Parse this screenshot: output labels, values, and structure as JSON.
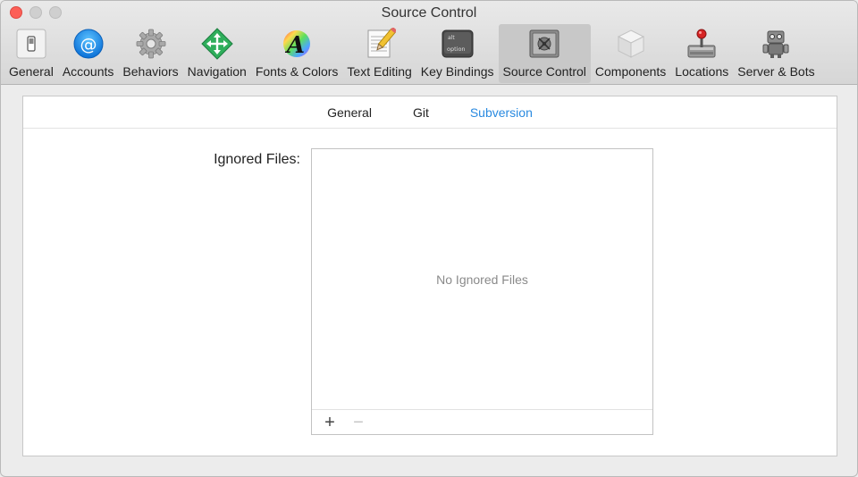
{
  "window": {
    "title": "Source Control"
  },
  "toolbar": {
    "items": [
      {
        "label": "General",
        "icon": "general-switch-icon"
      },
      {
        "label": "Accounts",
        "icon": "at-sign-icon"
      },
      {
        "label": "Behaviors",
        "icon": "gear-icon"
      },
      {
        "label": "Navigation",
        "icon": "arrows-diamond-icon"
      },
      {
        "label": "Fonts & Colors",
        "icon": "font-color-icon"
      },
      {
        "label": "Text Editing",
        "icon": "pencil-paper-icon"
      },
      {
        "label": "Key Bindings",
        "icon": "option-key-icon"
      },
      {
        "label": "Source Control",
        "icon": "vault-icon"
      },
      {
        "label": "Components",
        "icon": "cube-icon"
      },
      {
        "label": "Locations",
        "icon": "joystick-drive-icon"
      },
      {
        "label": "Server & Bots",
        "icon": "robot-icon"
      }
    ],
    "selected": "Source Control",
    "icon_key_text": {
      "top": "alt",
      "bottom": "option"
    }
  },
  "subtabs": {
    "items": [
      "General",
      "Git",
      "Subversion"
    ],
    "selected": "Subversion",
    "selected_color": "#2a8ae0"
  },
  "ignored_files": {
    "label": "Ignored Files:",
    "empty_text": "No Ignored Files",
    "add_symbol": "+",
    "remove_symbol": "−"
  }
}
